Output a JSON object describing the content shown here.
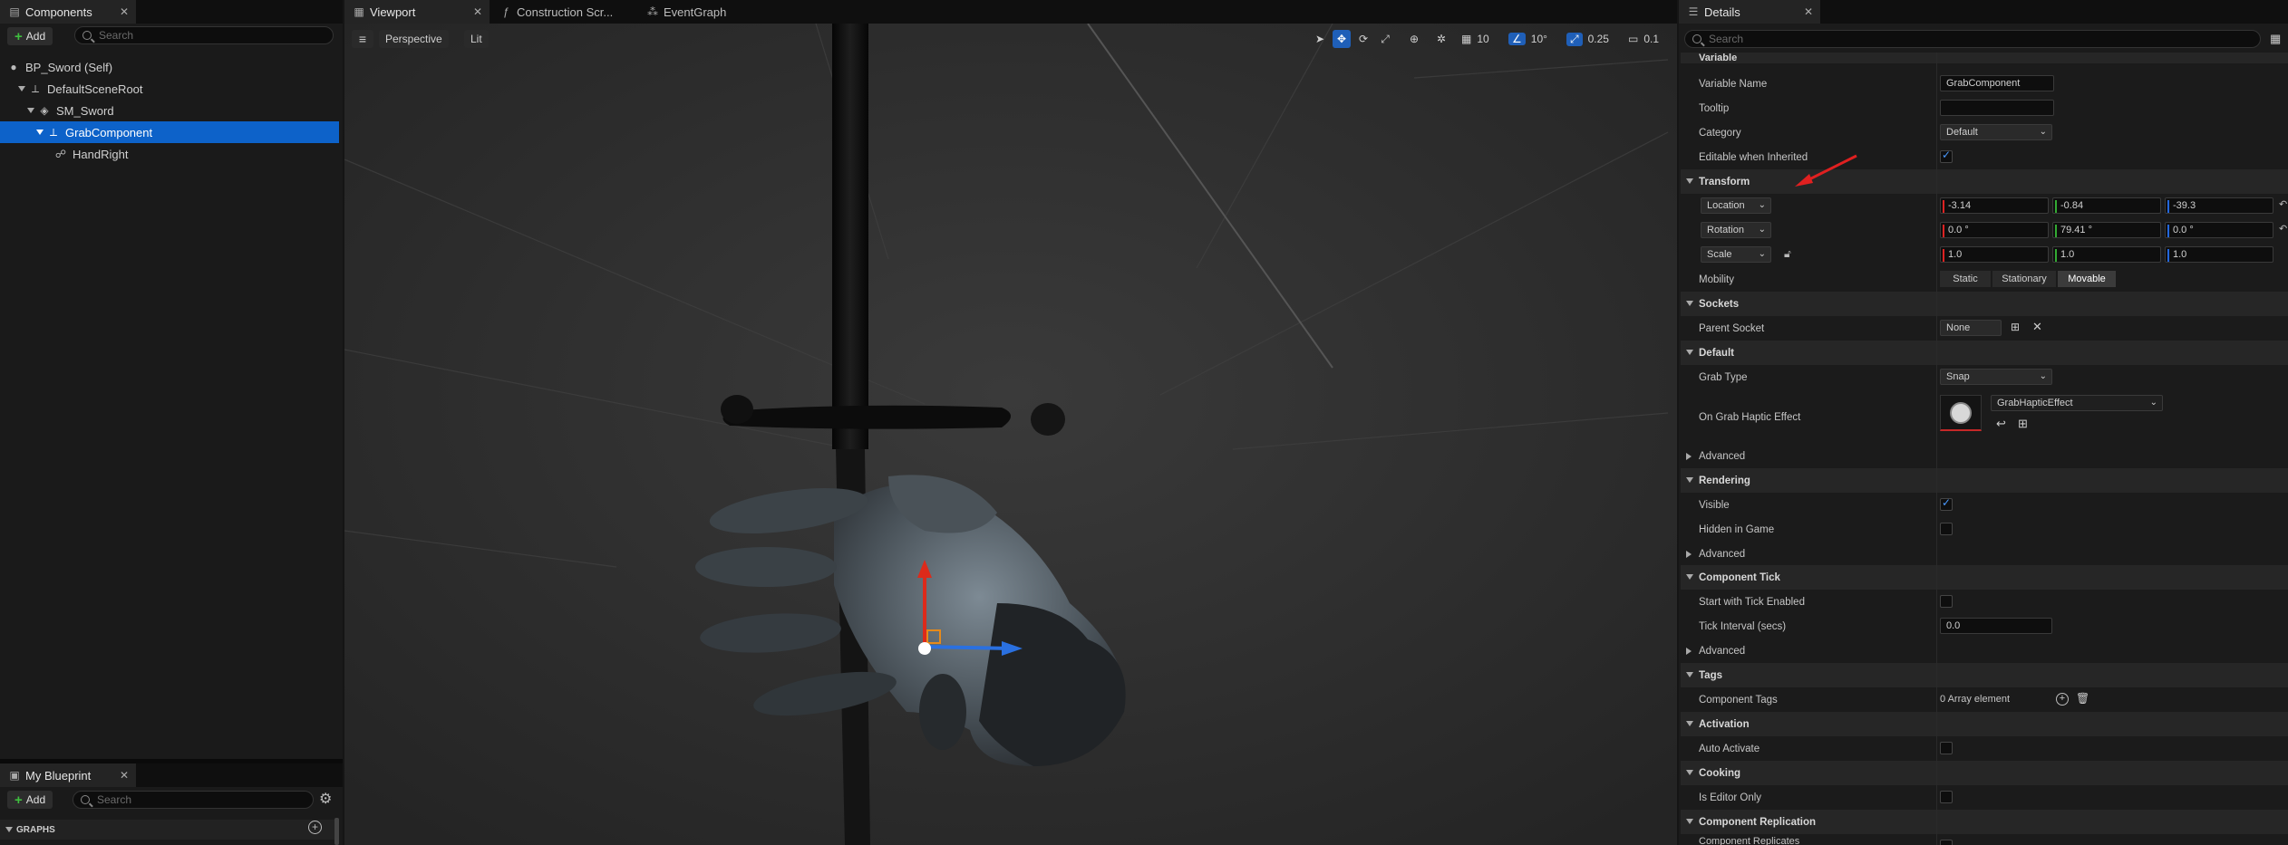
{
  "left_panel": {
    "tab_label": "Components",
    "add_label": "Add",
    "search_placeholder": "Search",
    "tree": [
      {
        "label": "BP_Sword (Self)"
      },
      {
        "label": "DefaultSceneRoot"
      },
      {
        "label": "SM_Sword"
      },
      {
        "label": "GrabComponent"
      },
      {
        "label": "HandRight"
      }
    ]
  },
  "my_blueprint": {
    "tab_label": "My Blueprint",
    "add_label": "Add",
    "search_placeholder": "Search",
    "graphs_label": "GRAPHS"
  },
  "editor_tabs": [
    {
      "label": "Viewport"
    },
    {
      "label": "Construction Scr..."
    },
    {
      "label": "EventGraph"
    }
  ],
  "viewport": {
    "perspective_label": "Perspective",
    "lit_label": "Lit",
    "grid_snap": "10",
    "rotation_snap": "10°",
    "scale_snap": "0.25",
    "camera_speed": "0.1"
  },
  "details": {
    "tab_label": "Details",
    "search_placeholder": "Search",
    "partial_header": "Variable",
    "variable_name_label": "Variable Name",
    "variable_name_value": "GrabComponent",
    "tooltip_label": "Tooltip",
    "category_label": "Category",
    "category_value": "Default",
    "editable_label": "Editable when Inherited",
    "transform_label": "Transform",
    "location_label": "Location",
    "location": [
      "-3.14",
      "-0.84",
      "-39.3"
    ],
    "rotation_label": "Rotation",
    "rotation": [
      "0.0 °",
      "79.41 °",
      "0.0 °"
    ],
    "scale_label": "Scale",
    "scale": [
      "1.0",
      "1.0",
      "1.0"
    ],
    "mobility_label": "Mobility",
    "mobility_options": [
      "Static",
      "Stationary",
      "Movable"
    ],
    "sockets_label": "Sockets",
    "parent_socket_label": "Parent Socket",
    "parent_socket_value": "None",
    "default_label": "Default",
    "grab_type_label": "Grab Type",
    "grab_type_value": "Snap",
    "haptic_label": "On Grab Haptic Effect",
    "haptic_value": "GrabHapticEffect",
    "advanced_label": "Advanced",
    "rendering_label": "Rendering",
    "visible_label": "Visible",
    "hidden_label": "Hidden in Game",
    "component_tick_label": "Component Tick",
    "tick_enabled_label": "Start with Tick Enabled",
    "tick_interval_label": "Tick Interval (secs)",
    "tick_interval_value": "0.0",
    "tags_label": "Tags",
    "component_tags_label": "Component Tags",
    "component_tags_value": "0 Array element",
    "activation_label": "Activation",
    "auto_activate_label": "Auto Activate",
    "cooking_label": "Cooking",
    "editor_only_label": "Is Editor Only",
    "replication_label": "Component Replication",
    "replication_partial": "Component Replicates"
  },
  "colors": {
    "selection": "#0d62c9",
    "accent_blue": "#1f5fb8",
    "annotation_arrow": "#e02020",
    "axis_x": "#d22",
    "axis_y": "#3a3",
    "axis_z": "#26d"
  }
}
